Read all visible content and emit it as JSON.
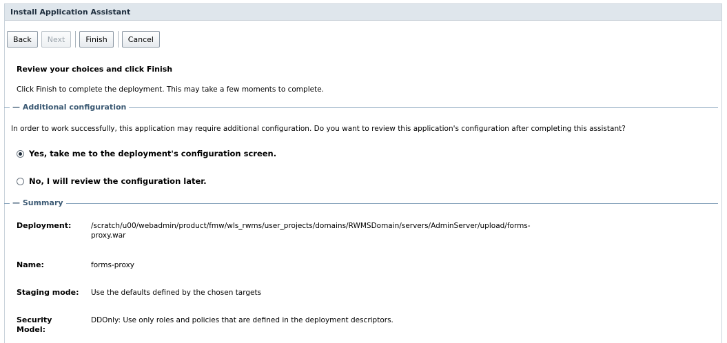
{
  "window": {
    "title": "Install Application Assistant"
  },
  "buttons": {
    "back": "Back",
    "next": "Next",
    "finish": "Finish",
    "cancel": "Cancel"
  },
  "page": {
    "heading": "Review your choices and click Finish",
    "instructions": "Click Finish to complete the deployment. This may take a few moments to complete."
  },
  "additional_config": {
    "title": "Additional configuration",
    "description": "In order to work successfully, this application may require additional configuration. Do you want to review this application's configuration after completing this assistant?",
    "options": [
      {
        "label": "Yes, take me to the deployment's configuration screen.",
        "selected": true
      },
      {
        "label": "No, I will review the configuration later.",
        "selected": false
      }
    ]
  },
  "summary": {
    "title": "Summary",
    "rows": [
      {
        "label": "Deployment:",
        "value_line1": "/scratch/u00/webadmin/product/fmw/wls_rwms/user_projects/domains/RWMSDomain/servers/AdminServer/upload/forms-",
        "value_line2": "proxy.war"
      },
      {
        "label": "Name:",
        "value": "forms-proxy"
      },
      {
        "label": "Staging mode:",
        "value": "Use the defaults defined by the chosen targets"
      },
      {
        "label_line1": "Security",
        "label_line2": "Model:",
        "value": "DDOnly: Use only roles and policies that are defined in the deployment descriptors."
      }
    ]
  },
  "colors": {
    "title_bar_bg": "#dfe6ec",
    "section_title": "#3c5a74",
    "section_line": "#8aa5bd"
  }
}
